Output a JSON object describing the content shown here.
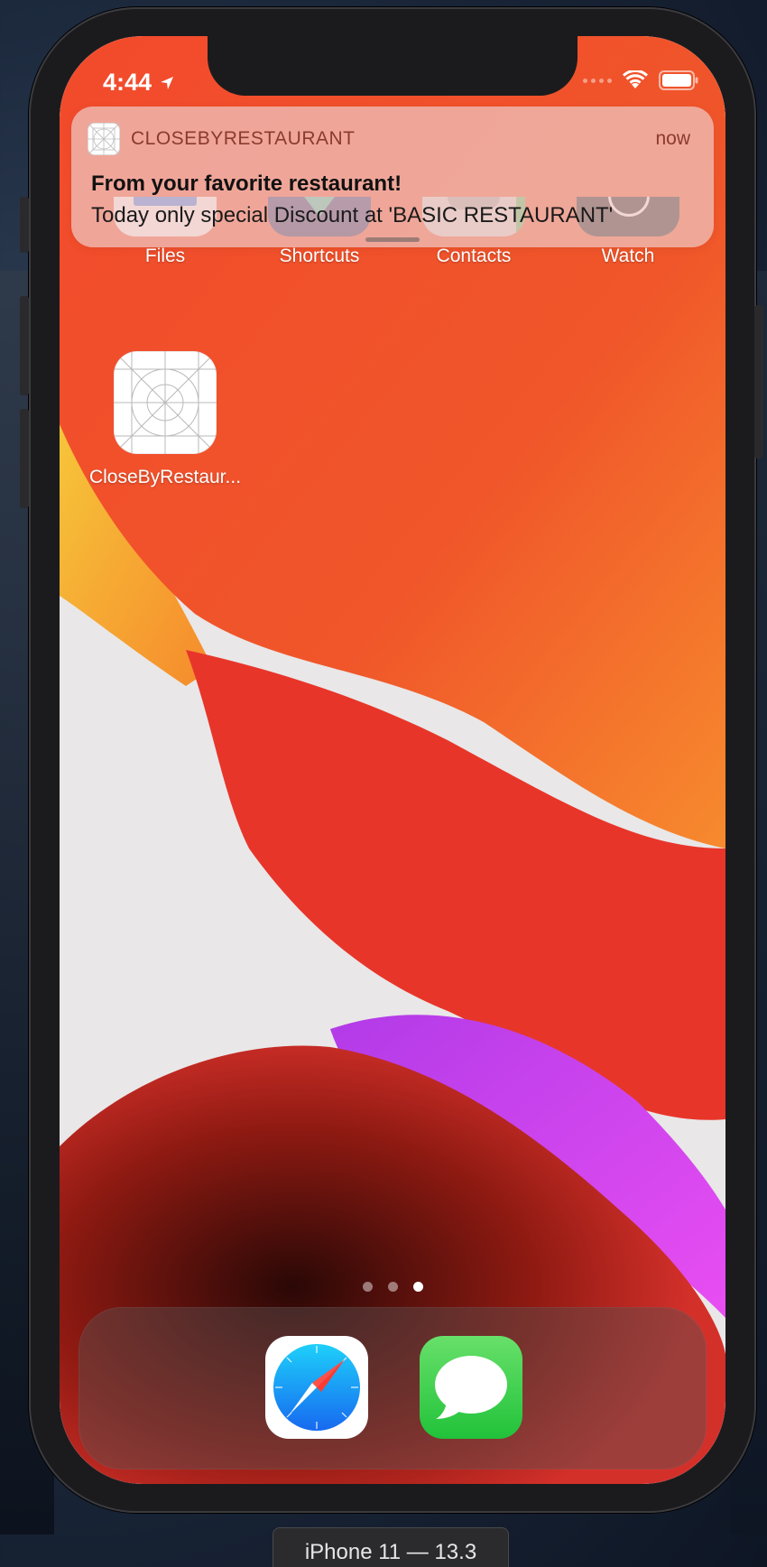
{
  "status_bar": {
    "time": "4:44"
  },
  "notification": {
    "app_name": "CLOSEBYRESTAURANT",
    "time": "now",
    "title": "From your favorite restaurant!",
    "body": "Today only special Discount at 'BASIC RESTAURANT'"
  },
  "home_apps": [
    {
      "label": "Files",
      "icon": "files-icon"
    },
    {
      "label": "Shortcuts",
      "icon": "shortcuts-icon"
    },
    {
      "label": "Contacts",
      "icon": "contacts-icon"
    },
    {
      "label": "Watch",
      "icon": "watch-icon"
    },
    {
      "label": "CloseByRestaur...",
      "icon": "app-placeholder-icon"
    }
  ],
  "page_indicator": {
    "pages": 3,
    "current": 3
  },
  "dock": [
    {
      "name": "Safari",
      "icon": "safari-icon"
    },
    {
      "name": "Messages",
      "icon": "messages-icon"
    }
  ],
  "simulator": {
    "device_label": "iPhone 11 — 13.3"
  },
  "colors": {
    "wallpaper_red": "#e8392a",
    "wallpaper_orange": "#f26b2a",
    "wallpaper_yellow": "#f7d23a",
    "wallpaper_magenta": "#d646f0",
    "notification_accent": "#8a3a2e"
  }
}
